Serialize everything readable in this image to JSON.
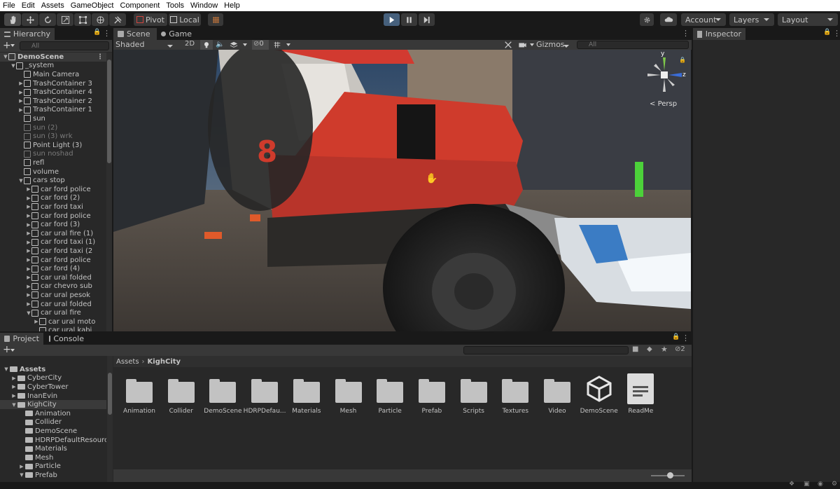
{
  "menu": [
    "File",
    "Edit",
    "Assets",
    "GameObject",
    "Component",
    "Tools",
    "Window",
    "Help"
  ],
  "toolbar": {
    "pivot_label": "Pivot",
    "local_label": "Local",
    "account_label": "Account",
    "layers_label": "Layers",
    "layout_label": "Layout"
  },
  "hierarchy": {
    "tab_label": "Hierarchy",
    "search_placeholder": "All",
    "items": [
      {
        "label": "DemoScene",
        "indent": 0,
        "arrow": "down",
        "bold": true,
        "scene": true
      },
      {
        "label": "_system",
        "indent": 1,
        "arrow": "down"
      },
      {
        "label": "Main Camera",
        "indent": 2,
        "arrow": ""
      },
      {
        "label": "TrashContainer 3",
        "indent": 2,
        "arrow": "right"
      },
      {
        "label": "TrashContainer 4",
        "indent": 2,
        "arrow": "right"
      },
      {
        "label": "TrashContainer 2",
        "indent": 2,
        "arrow": "right"
      },
      {
        "label": "TrashContainer 1",
        "indent": 2,
        "arrow": "right"
      },
      {
        "label": "sun",
        "indent": 2,
        "arrow": ""
      },
      {
        "label": "sun (2)",
        "indent": 2,
        "arrow": "",
        "dim": true
      },
      {
        "label": "sun (3) wrk",
        "indent": 2,
        "arrow": "",
        "dim": true
      },
      {
        "label": "Point Light (3)",
        "indent": 2,
        "arrow": ""
      },
      {
        "label": "sun noshad",
        "indent": 2,
        "arrow": "",
        "dim": true
      },
      {
        "label": "refl",
        "indent": 2,
        "arrow": ""
      },
      {
        "label": "volume",
        "indent": 2,
        "arrow": ""
      },
      {
        "label": "cars stop",
        "indent": 2,
        "arrow": "down"
      },
      {
        "label": "car ford police",
        "indent": 3,
        "arrow": "right"
      },
      {
        "label": "car ford (2)",
        "indent": 3,
        "arrow": "right"
      },
      {
        "label": "car ford taxi",
        "indent": 3,
        "arrow": "right"
      },
      {
        "label": "car ford police",
        "indent": 3,
        "arrow": "right"
      },
      {
        "label": "car ford (3)",
        "indent": 3,
        "arrow": "right"
      },
      {
        "label": "car ural fire (1)",
        "indent": 3,
        "arrow": "right"
      },
      {
        "label": "car ford taxi (1)",
        "indent": 3,
        "arrow": "right"
      },
      {
        "label": "car ford taxi (2",
        "indent": 3,
        "arrow": "right"
      },
      {
        "label": "car ford police",
        "indent": 3,
        "arrow": "right"
      },
      {
        "label": "car ford (4)",
        "indent": 3,
        "arrow": "right"
      },
      {
        "label": "car ural folded",
        "indent": 3,
        "arrow": "right"
      },
      {
        "label": "car chevro sub",
        "indent": 3,
        "arrow": "right"
      },
      {
        "label": "car ural pesok",
        "indent": 3,
        "arrow": "right"
      },
      {
        "label": "car ural folded",
        "indent": 3,
        "arrow": "right"
      },
      {
        "label": "car ural fire",
        "indent": 3,
        "arrow": "down"
      },
      {
        "label": "car ural moto",
        "indent": 4,
        "arrow": "right"
      },
      {
        "label": "car ural kabi",
        "indent": 4,
        "arrow": ""
      }
    ]
  },
  "scene": {
    "tab_scene": "Scene",
    "tab_game": "Game",
    "shading_mode": "Shaded",
    "mode_2d": "2D",
    "hidden_count": "0",
    "gizmos_label": "Gizmos",
    "search_placeholder": "All",
    "persp_label": "Persp",
    "axis_y": "y",
    "axis_z": "z"
  },
  "inspector": {
    "tab_label": "Inspector"
  },
  "project": {
    "tab_project": "Project",
    "tab_console": "Console",
    "breadcrumb_root": "Assets",
    "breadcrumb_current": "KighCity",
    "hidden_count": "2",
    "tree": [
      {
        "label": "Assets",
        "indent": 0,
        "arrow": "down",
        "bold": true
      },
      {
        "label": "CyberCity",
        "indent": 1,
        "arrow": "right"
      },
      {
        "label": "CyberTower",
        "indent": 1,
        "arrow": "right"
      },
      {
        "label": "InanEvin",
        "indent": 1,
        "arrow": "right"
      },
      {
        "label": "KighCity",
        "indent": 1,
        "arrow": "down",
        "selected": true
      },
      {
        "label": "Animation",
        "indent": 2,
        "arrow": ""
      },
      {
        "label": "Collider",
        "indent": 2,
        "arrow": ""
      },
      {
        "label": "DemoScene",
        "indent": 2,
        "arrow": ""
      },
      {
        "label": "HDRPDefaultResources",
        "indent": 2,
        "arrow": ""
      },
      {
        "label": "Materials",
        "indent": 2,
        "arrow": ""
      },
      {
        "label": "Mesh",
        "indent": 2,
        "arrow": ""
      },
      {
        "label": "Particle",
        "indent": 2,
        "arrow": "right"
      },
      {
        "label": "Prefab",
        "indent": 2,
        "arrow": "down"
      }
    ],
    "assets": [
      {
        "label": "Animation",
        "kind": "folder"
      },
      {
        "label": "Collider",
        "kind": "folder"
      },
      {
        "label": "DemoScene",
        "kind": "folder"
      },
      {
        "label": "HDRPDefau...",
        "kind": "folder"
      },
      {
        "label": "Materials",
        "kind": "folder"
      },
      {
        "label": "Mesh",
        "kind": "folder"
      },
      {
        "label": "Particle",
        "kind": "folder"
      },
      {
        "label": "Prefab",
        "kind": "folder"
      },
      {
        "label": "Scripts",
        "kind": "folder"
      },
      {
        "label": "Textures",
        "kind": "folder"
      },
      {
        "label": "Video",
        "kind": "folder"
      },
      {
        "label": "DemoScene",
        "kind": "unity-scene"
      },
      {
        "label": "ReadMe",
        "kind": "document"
      }
    ]
  },
  "scene_image": {
    "truck_number": "8"
  }
}
